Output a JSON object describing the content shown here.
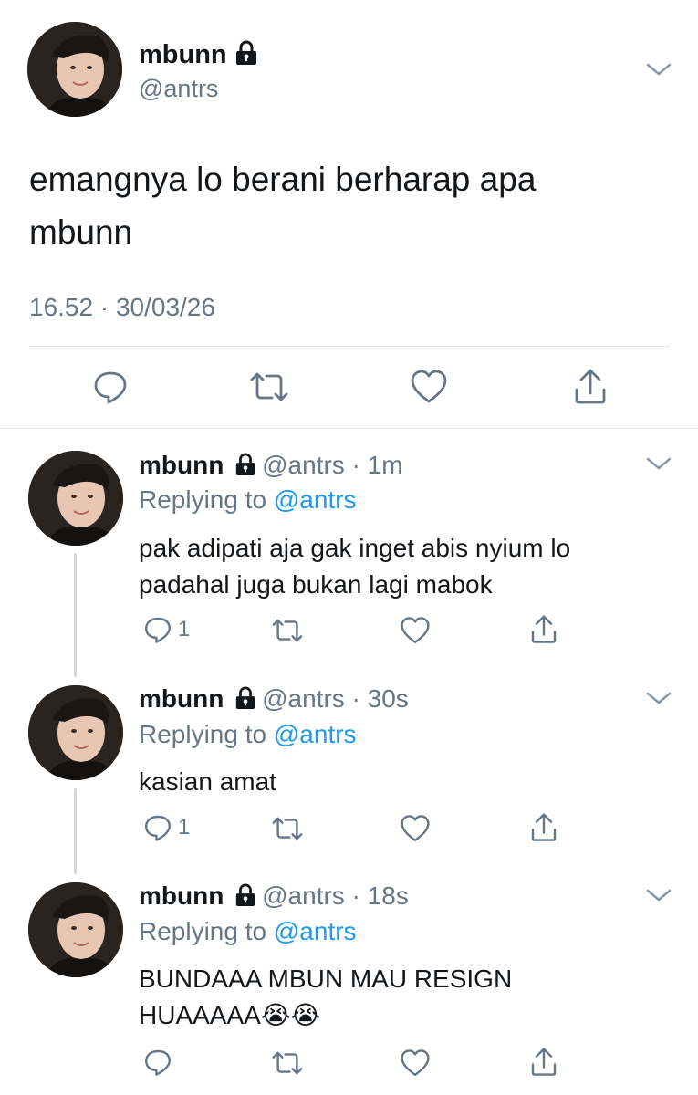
{
  "main_tweet": {
    "name": "mbunn",
    "handle": "@antrs",
    "text_line1": "emangnya lo berani berharap apa",
    "text_line2": "mbunn",
    "timestamp": "16.52 · 30/03/26"
  },
  "replies": [
    {
      "name": "mbunn",
      "handle": "@antrs",
      "time": "· 1m",
      "replying_prefix": "Replying to",
      "replying_to": "@antrs",
      "text_line1": "pak adipati aja gak inget abis nyium lo",
      "text_line2": "padahal juga bukan lagi mabok",
      "reply_count": "1"
    },
    {
      "name": "mbunn",
      "handle": "@antrs",
      "time": "· 30s",
      "replying_prefix": "Replying to",
      "replying_to": "@antrs",
      "text_line1": "kasian amat",
      "reply_count": "1"
    },
    {
      "name": "mbunn",
      "handle": "@antrs",
      "time": "· 18s",
      "replying_prefix": "Replying to",
      "replying_to": "@antrs",
      "text_line1": "BUNDAAA MBUN MAU RESIGN",
      "text_line2": "HUAAAAA😭😭",
      "reply_count": ""
    }
  ],
  "icons": {
    "reply": "speech-bubble-icon",
    "retweet": "retweet-arrows-icon",
    "like": "heart-outline-icon",
    "share": "share-upload-icon",
    "lock": "padlock-icon",
    "more": "chevron-down-icon"
  },
  "colors": {
    "text": "#14171a",
    "secondary": "#657786",
    "link": "#1d9bf0",
    "divider": "#e1e8ed"
  }
}
